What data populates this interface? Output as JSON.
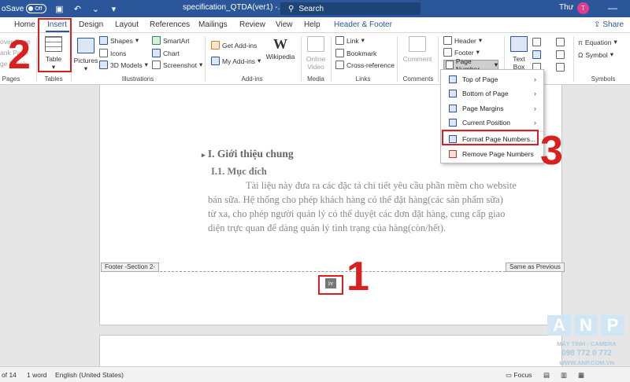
{
  "titlebar": {
    "autosave_label": "oSave",
    "toggle_label": "Off",
    "doc_name": "specification_QTDA(ver1) -...",
    "search_placeholder": "Search",
    "user_name": "Thư",
    "avatar_initial": "T",
    "minimize_glyph": "—"
  },
  "tabs": {
    "home": "Home",
    "insert": "Insert",
    "design": "Design",
    "layout": "Layout",
    "references": "References",
    "mailings": "Mailings",
    "review": "Review",
    "view": "View",
    "help": "Help",
    "header_footer": "Header & Footer",
    "share": "Share"
  },
  "ribbon": {
    "pages": {
      "cover_page": "over Page",
      "blank_page": "ank Page",
      "page_break": "ge Break",
      "label": "Pages"
    },
    "tables": {
      "table": "Table",
      "label": "Tables"
    },
    "illustrations": {
      "pictures": "Pictures",
      "shapes": "Shapes",
      "icons": "Icons",
      "models": "3D Models",
      "smartart": "SmartArt",
      "chart": "Chart",
      "screenshot": "Screenshot",
      "label": "Illustrations"
    },
    "addins": {
      "get": "Get Add-ins",
      "my": "My Add-ins",
      "wikipedia": "Wikipedia",
      "label": "Add-ins"
    },
    "media": {
      "online_video": "Online Video",
      "label": "Media"
    },
    "links": {
      "link": "Link",
      "bookmark": "Bookmark",
      "cross_reference": "Cross-reference",
      "label": "Links"
    },
    "comments": {
      "comment": "Comment",
      "label": "Comments"
    },
    "header_footer": {
      "header": "Header",
      "footer": "Footer",
      "page_number": "Page Number"
    },
    "text": {
      "text_box": "Text Box"
    },
    "symbols": {
      "equation": "Equation",
      "symbol": "Symbol",
      "label": "Symbols"
    }
  },
  "menu": {
    "items": [
      {
        "label": "Top of Page",
        "has_submenu": true
      },
      {
        "label": "Bottom of Page",
        "has_submenu": true
      },
      {
        "label": "Page Margins",
        "has_submenu": true
      },
      {
        "label": "Current Position",
        "has_submenu": true
      },
      {
        "label": "Format Page Numbers...",
        "has_submenu": false
      },
      {
        "label": "Remove Page Numbers",
        "has_submenu": false
      }
    ]
  },
  "document": {
    "heading1": "I. Giới thiệu chung",
    "heading2": "I.1. Mục đích",
    "paragraph_lines": [
      "Tài liệu này đưa ra các đặc tả chi tiết yêu cầu phần mềm cho website",
      "bán sữa. Hệ thống cho phép khách hàng có thể đặt hàng(các sản phẩm sữa)",
      "từ xa, cho phép người quản lý có thể duyệt các đơn đặt hàng, cung cấp giao",
      "diện trực quan để dàng quản lý tình trạng của hàng(còn/hết)."
    ],
    "footer_tag": "Footer -Section 2-",
    "same_as_previous": "Same as Previous",
    "page_number": "iv"
  },
  "annotations": {
    "step1": "1",
    "step2": "2",
    "step3": "3"
  },
  "statusbar": {
    "pages": "of 14",
    "words": "1 word",
    "language": "English (United States)",
    "focus": "Focus"
  },
  "watermark": {
    "letters": [
      "A",
      "N",
      "P"
    ],
    "line1": "MÁY TÍNH - CAMERA",
    "line2": "098 772 0 772",
    "line3": "WWW.ANP.COM.VN"
  },
  "colors": {
    "word_blue": "#2b579a",
    "annotation_red": "#d9201f"
  }
}
